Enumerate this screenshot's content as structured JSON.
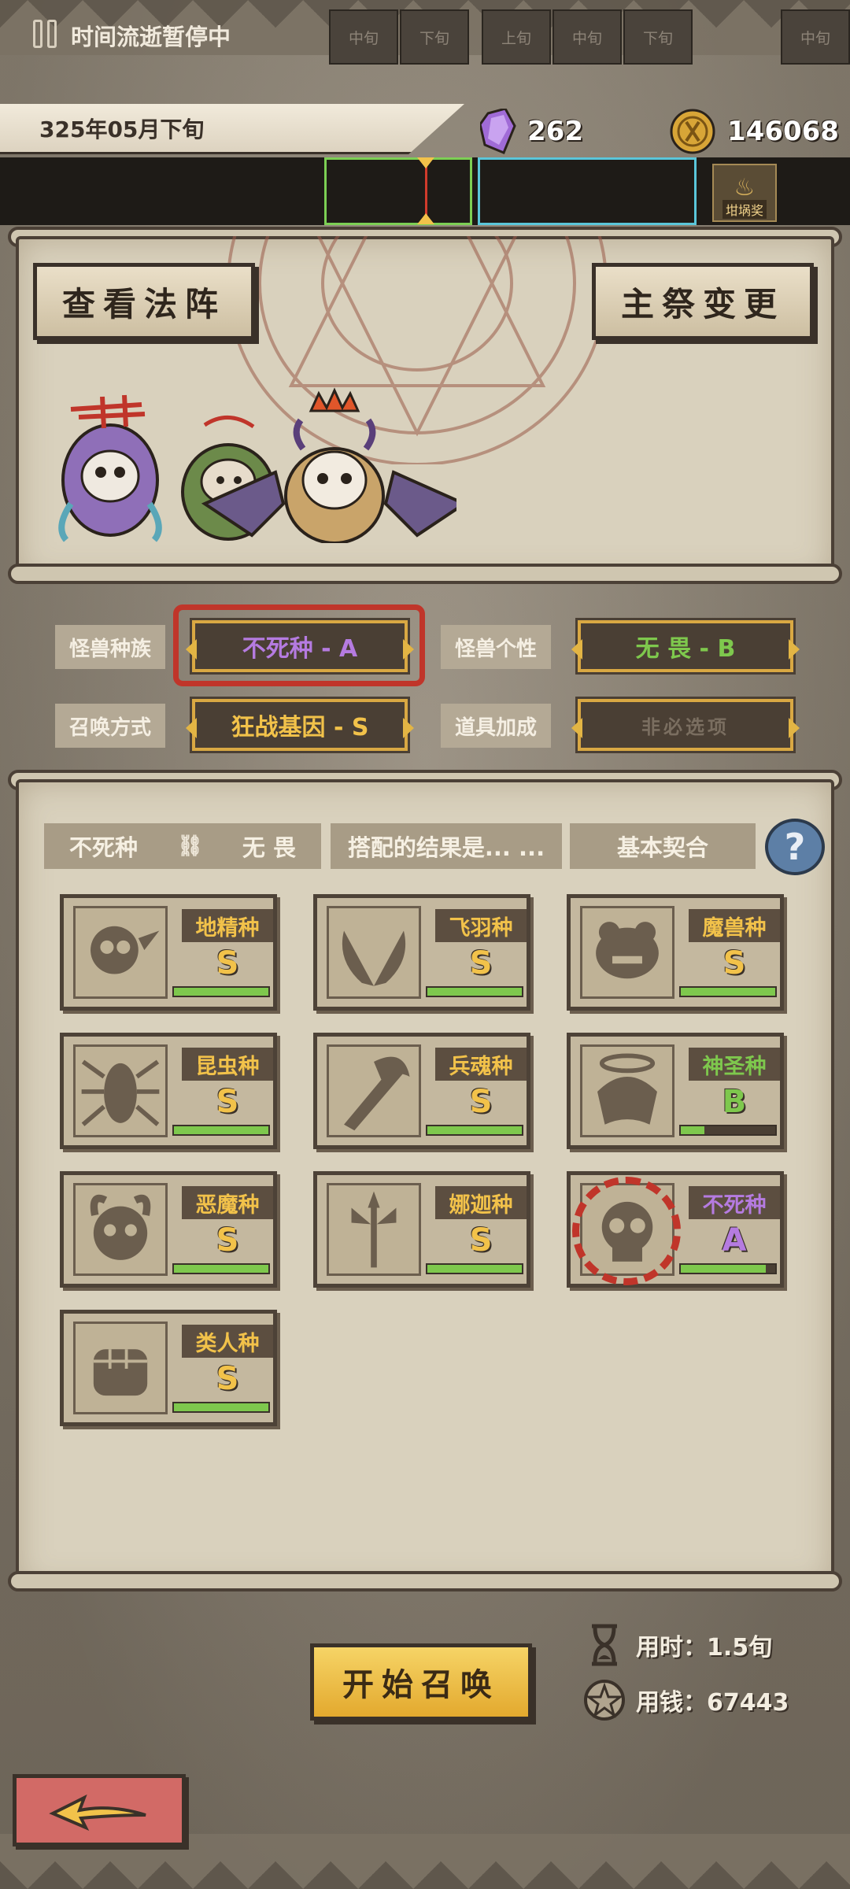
{
  "header": {
    "date": "325年05月下旬",
    "gems": "262",
    "coins": "146068"
  },
  "timebar": {
    "status": "时间流逝暂停中",
    "cells": [
      "中旬",
      "下旬",
      "上旬",
      "中旬",
      "下旬",
      "中旬"
    ],
    "pot_label": "坩埚奖"
  },
  "top_panel": {
    "view_formation": "查看法阵",
    "change_host": "主祭变更"
  },
  "attributes": [
    {
      "label": "怪兽种族",
      "value": "不死种 - A",
      "color": "#b57be0"
    },
    {
      "label": "怪兽个性",
      "value": "无 畏 - B",
      "color": "#7ec84d"
    },
    {
      "label": "召唤方式",
      "value": "狂战基因 - S",
      "color": "#f2c24a"
    },
    {
      "label": "道具加成",
      "value": "非必选项",
      "color": "#7a6e60"
    }
  ],
  "tabs": {
    "race": "不死种",
    "trait": "无 畏",
    "result": "搭配的结果是... ...",
    "contract": "基本契合",
    "help": "?"
  },
  "species": [
    {
      "name": "地精种",
      "grade": "S",
      "bar": 1.0,
      "icon": "skull-bird-icon"
    },
    {
      "name": "飞羽种",
      "grade": "S",
      "bar": 1.0,
      "icon": "wings-icon"
    },
    {
      "name": "魔兽种",
      "grade": "S",
      "bar": 1.0,
      "icon": "beast-icon"
    },
    {
      "name": "昆虫种",
      "grade": "S",
      "bar": 1.0,
      "icon": "bug-icon"
    },
    {
      "name": "兵魂种",
      "grade": "S",
      "bar": 1.0,
      "icon": "sword-icon"
    },
    {
      "name": "神圣种",
      "grade": "B",
      "bar": 0.25,
      "icon": "halo-icon",
      "grade_color": "#7ec84d",
      "name_color": "#7ec84d"
    },
    {
      "name": "恶魔种",
      "grade": "S",
      "bar": 1.0,
      "icon": "demon-icon"
    },
    {
      "name": "娜迦种",
      "grade": "S",
      "bar": 1.0,
      "icon": "trident-icon"
    },
    {
      "name": "不死种",
      "grade": "A",
      "bar": 0.9,
      "icon": "undead-skull-icon",
      "grade_color": "#b57be0",
      "name_color": "#b57be0",
      "selected": true
    },
    {
      "name": "类人种",
      "grade": "S",
      "bar": 1.0,
      "icon": "fist-icon"
    }
  ],
  "footer": {
    "start": "开始召唤",
    "time_cost": "用时：1.5旬",
    "money_cost": "用钱：67443"
  }
}
